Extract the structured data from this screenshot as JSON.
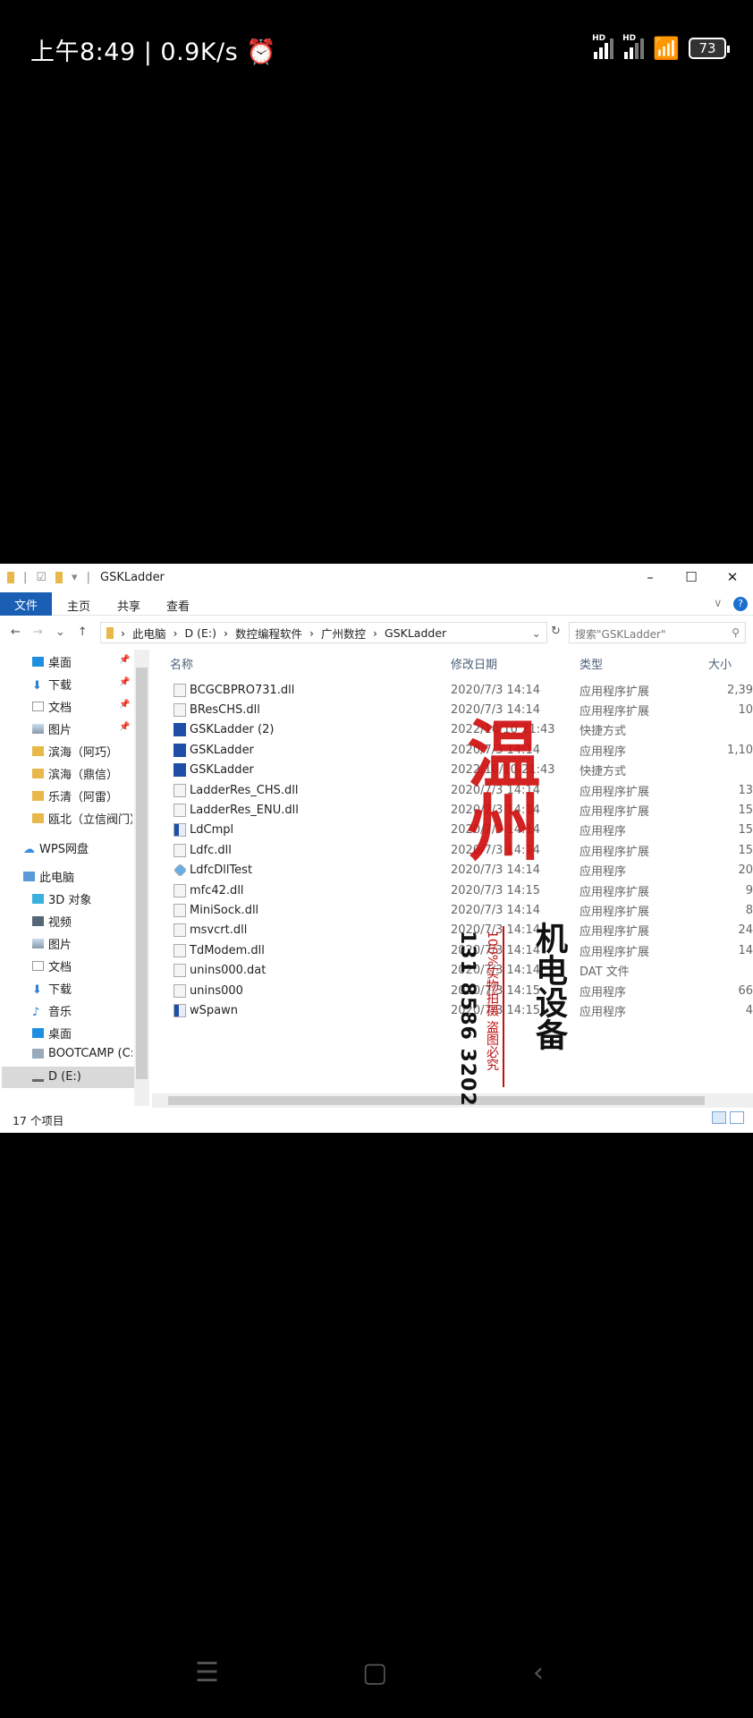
{
  "status": {
    "time": "上午8:49",
    "speed": "0.9K/s",
    "signal_label": "HD",
    "battery": "73"
  },
  "window": {
    "title": "GSKLadder",
    "controls": {
      "minimize": "–",
      "maximize": "☐",
      "close": "✕"
    },
    "ribbon": {
      "tabs": [
        "文件",
        "主页",
        "共享",
        "查看"
      ],
      "help": "?"
    },
    "address": {
      "crumbs": [
        "此电脑",
        "D (E:)",
        "数控编程软件",
        "广州数控",
        "GSKLadder"
      ],
      "search_placeholder": "搜索\"GSKLadder\""
    },
    "sidebar": {
      "quick": [
        {
          "label": "桌面",
          "pinned": true
        },
        {
          "label": "下载",
          "pinned": true
        },
        {
          "label": "文档",
          "pinned": true
        },
        {
          "label": "图片",
          "pinned": true
        },
        {
          "label": "滨海（阿巧）"
        },
        {
          "label": "滨海（鼎信）"
        },
        {
          "label": "乐清（阿雷）"
        },
        {
          "label": "瓯北（立信阀门）"
        }
      ],
      "wps": "WPS网盘",
      "pc": "此电脑",
      "pc_items": [
        "3D 对象",
        "视频",
        "图片",
        "文档",
        "下载",
        "音乐",
        "桌面",
        "BOOTCAMP (C:",
        "D (E:)"
      ]
    },
    "columns": {
      "name": "名称",
      "date": "修改日期",
      "type": "类型",
      "size": "大小"
    },
    "files": [
      {
        "name": "BCGCBPRO731.dll",
        "date": "2020/7/3 14:14",
        "type": "应用程序扩展",
        "size": "2,39",
        "icon": "dll"
      },
      {
        "name": "BResCHS.dll",
        "date": "2020/7/3 14:14",
        "type": "应用程序扩展",
        "size": "10",
        "icon": "dll"
      },
      {
        "name": "GSKLadder (2)",
        "date": "2022/10/10 21:43",
        "type": "快捷方式",
        "size": "",
        "icon": "exe"
      },
      {
        "name": "GSKLadder",
        "date": "2020/7/3 14:14",
        "type": "应用程序",
        "size": "1,10",
        "icon": "exe"
      },
      {
        "name": "GSKLadder",
        "date": "2022/10/10 21:43",
        "type": "快捷方式",
        "size": "",
        "icon": "exe"
      },
      {
        "name": "LadderRes_CHS.dll",
        "date": "2020/7/3 14:14",
        "type": "应用程序扩展",
        "size": "13",
        "icon": "dll"
      },
      {
        "name": "LadderRes_ENU.dll",
        "date": "2020/7/3 14:14",
        "type": "应用程序扩展",
        "size": "15",
        "icon": "dll"
      },
      {
        "name": "LdCmpl",
        "date": "2020/7/3 14:14",
        "type": "应用程序",
        "size": "15",
        "icon": "app"
      },
      {
        "name": "Ldfc.dll",
        "date": "2020/7/3 14:14",
        "type": "应用程序扩展",
        "size": "15",
        "icon": "dll"
      },
      {
        "name": "LdfcDllTest",
        "date": "2020/7/3 14:14",
        "type": "应用程序",
        "size": "20",
        "icon": "test"
      },
      {
        "name": "mfc42.dll",
        "date": "2020/7/3 14:15",
        "type": "应用程序扩展",
        "size": "9",
        "icon": "dll"
      },
      {
        "name": "MiniSock.dll",
        "date": "2020/7/3 14:14",
        "type": "应用程序扩展",
        "size": "8",
        "icon": "dll"
      },
      {
        "name": "msvcrt.dll",
        "date": "2020/7/3 14:14",
        "type": "应用程序扩展",
        "size": "24",
        "icon": "dll"
      },
      {
        "name": "TdModem.dll",
        "date": "2020/7/3 14:14",
        "type": "应用程序扩展",
        "size": "14",
        "icon": "dll"
      },
      {
        "name": "unins000.dat",
        "date": "2020/7/3 14:14",
        "type": "DAT 文件",
        "size": "",
        "icon": "dat"
      },
      {
        "name": "unins000",
        "date": "2020/7/3 14:15",
        "type": "应用程序",
        "size": "66",
        "icon": "unins"
      },
      {
        "name": "wSpawn",
        "date": "2020/7/3 14:15",
        "type": "应用程序",
        "size": "4",
        "icon": "app"
      }
    ],
    "status_text": "17 个项目"
  },
  "watermark": {
    "city": "温州",
    "business": "机电设备",
    "phone": "131 8586 3202",
    "note": "100%实物拍摄 盗图必究"
  },
  "navbar": {
    "menu": "☰",
    "home": "▢",
    "back": "‹"
  }
}
